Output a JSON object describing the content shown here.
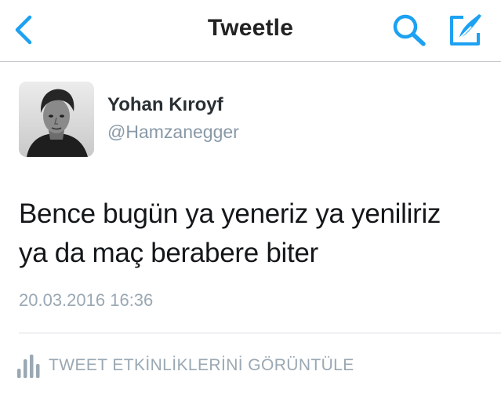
{
  "colors": {
    "accent": "#1da1f2",
    "title_text": "#222222",
    "muted_text": "#9aa8b3",
    "divider": "#c8c8cc"
  },
  "navbar": {
    "title": "Tweetle",
    "back_icon": "chevron-left-icon",
    "search_icon": "search-icon",
    "compose_icon": "compose-icon"
  },
  "tweet": {
    "author_name": "Yohan Kıroyf",
    "author_handle": "@Hamzanegger",
    "text_lines": [
      "Bence bugün ya yeneriz ya yeniliriz",
      "ya da maç berabere biter"
    ],
    "timestamp": "20.03.2016 16:36"
  },
  "footer": {
    "activity_icon": "bar-chart-icon",
    "activity_label": "TWEET ETKİNLİKLERİNİ GÖRÜNTÜLE"
  }
}
